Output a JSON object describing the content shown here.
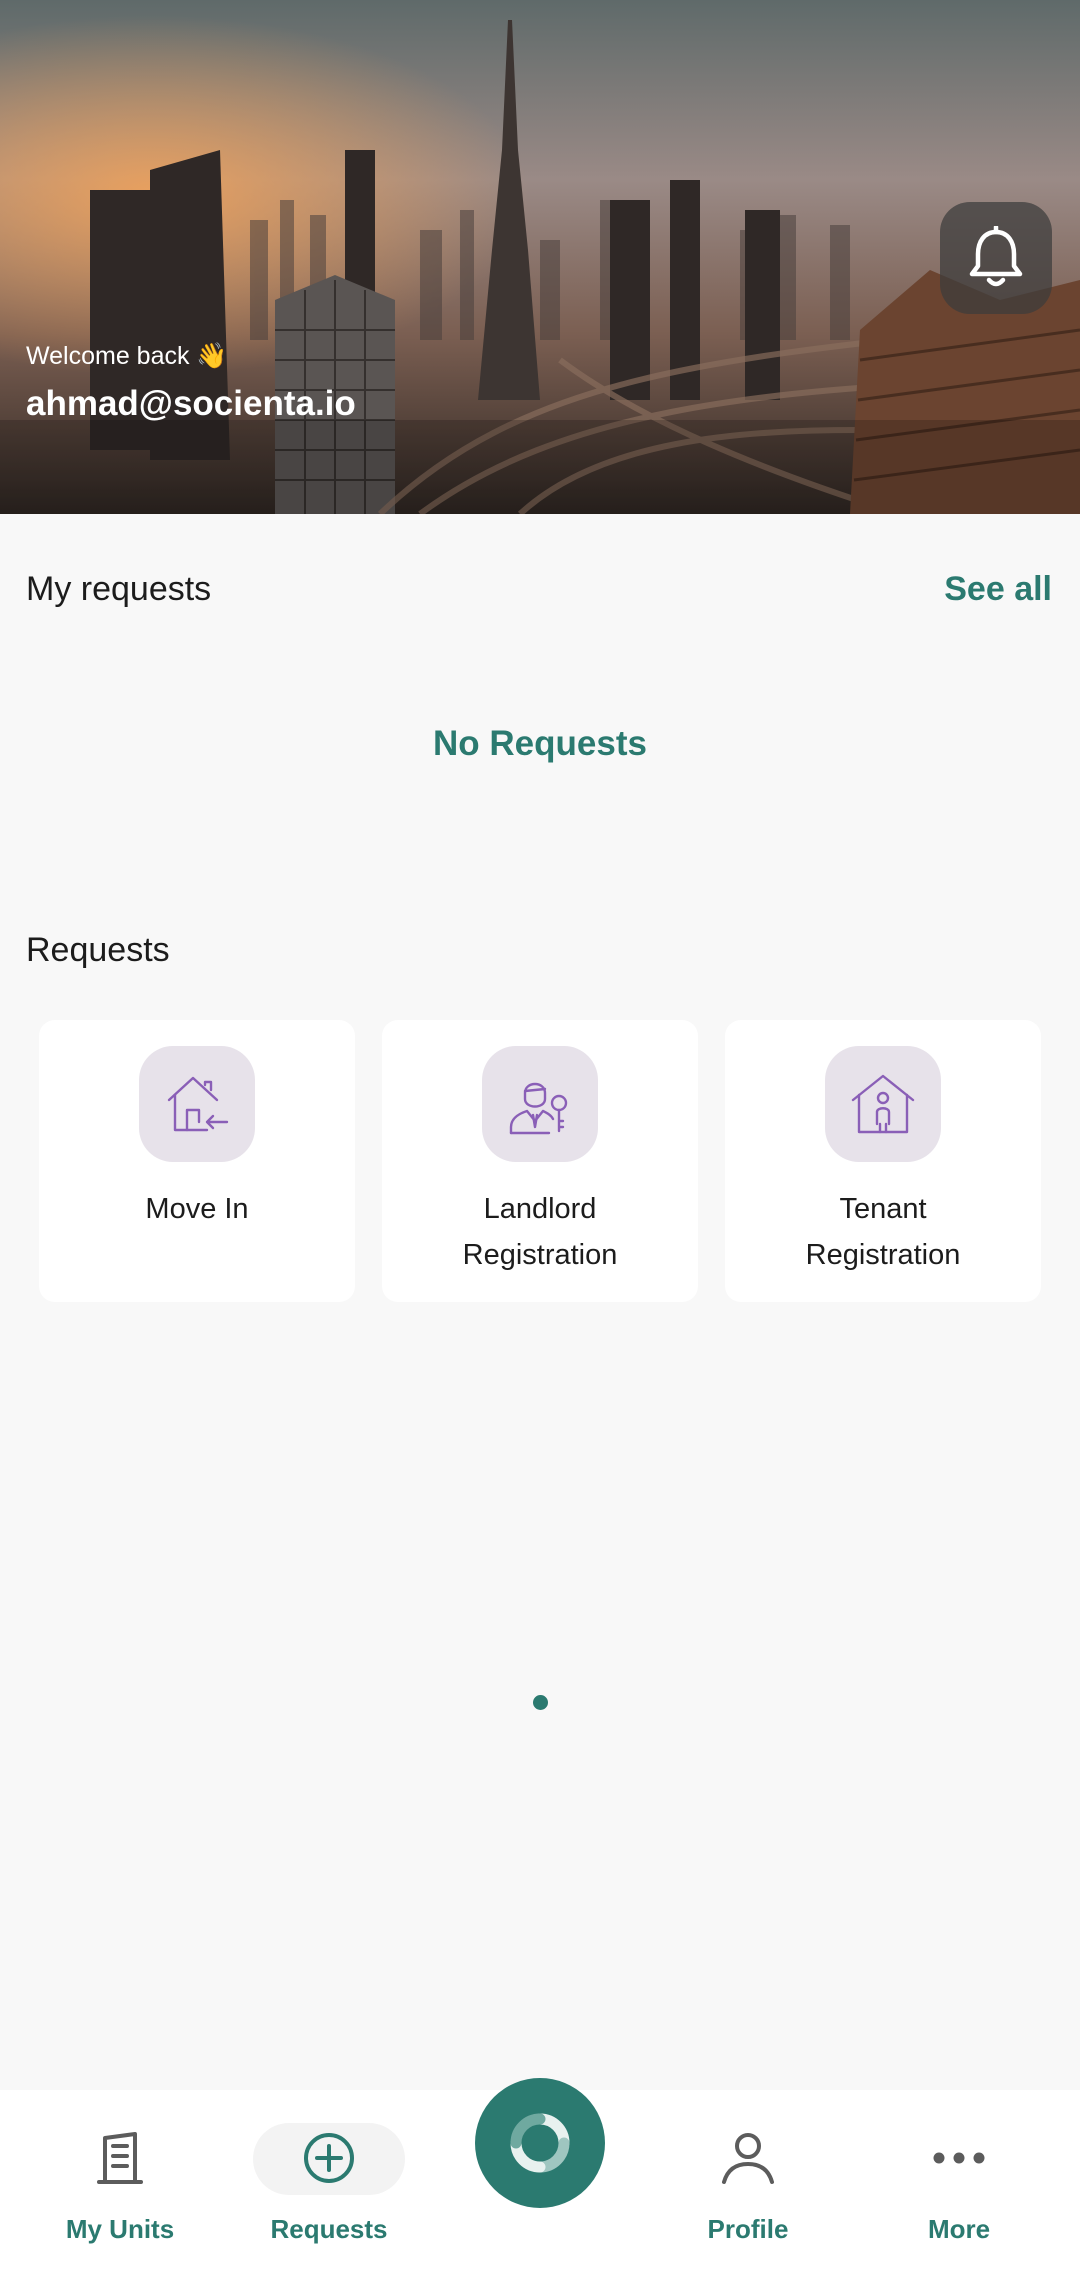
{
  "header": {
    "welcome": "Welcome back 👋",
    "email": "ahmad@socienta.io"
  },
  "my_requests": {
    "title": "My requests",
    "see_all": "See all",
    "empty": "No Requests"
  },
  "requests": {
    "title": "Requests",
    "cards": [
      {
        "label_lines": [
          "Move In"
        ],
        "icon": "house-move-in-icon"
      },
      {
        "label_lines": [
          "Landlord",
          "Registration"
        ],
        "icon": "landlord-key-icon"
      },
      {
        "label_lines": [
          "Tenant",
          "Registration"
        ],
        "icon": "tenant-house-icon"
      }
    ]
  },
  "nav": {
    "items": [
      {
        "label": "My Units",
        "icon": "building-icon"
      },
      {
        "label": "Requests",
        "icon": "plus-circle-icon",
        "active": true
      },
      {
        "label": "",
        "icon": "app-logo-icon"
      },
      {
        "label": "Profile",
        "icon": "person-icon"
      },
      {
        "label": "More",
        "icon": "more-dots-icon"
      }
    ]
  },
  "colors": {
    "accent": "#2b7a70",
    "icon_bg": "#e7e2ea",
    "icon_stroke": "#8a5fb7",
    "background": "#f8f8f8"
  }
}
